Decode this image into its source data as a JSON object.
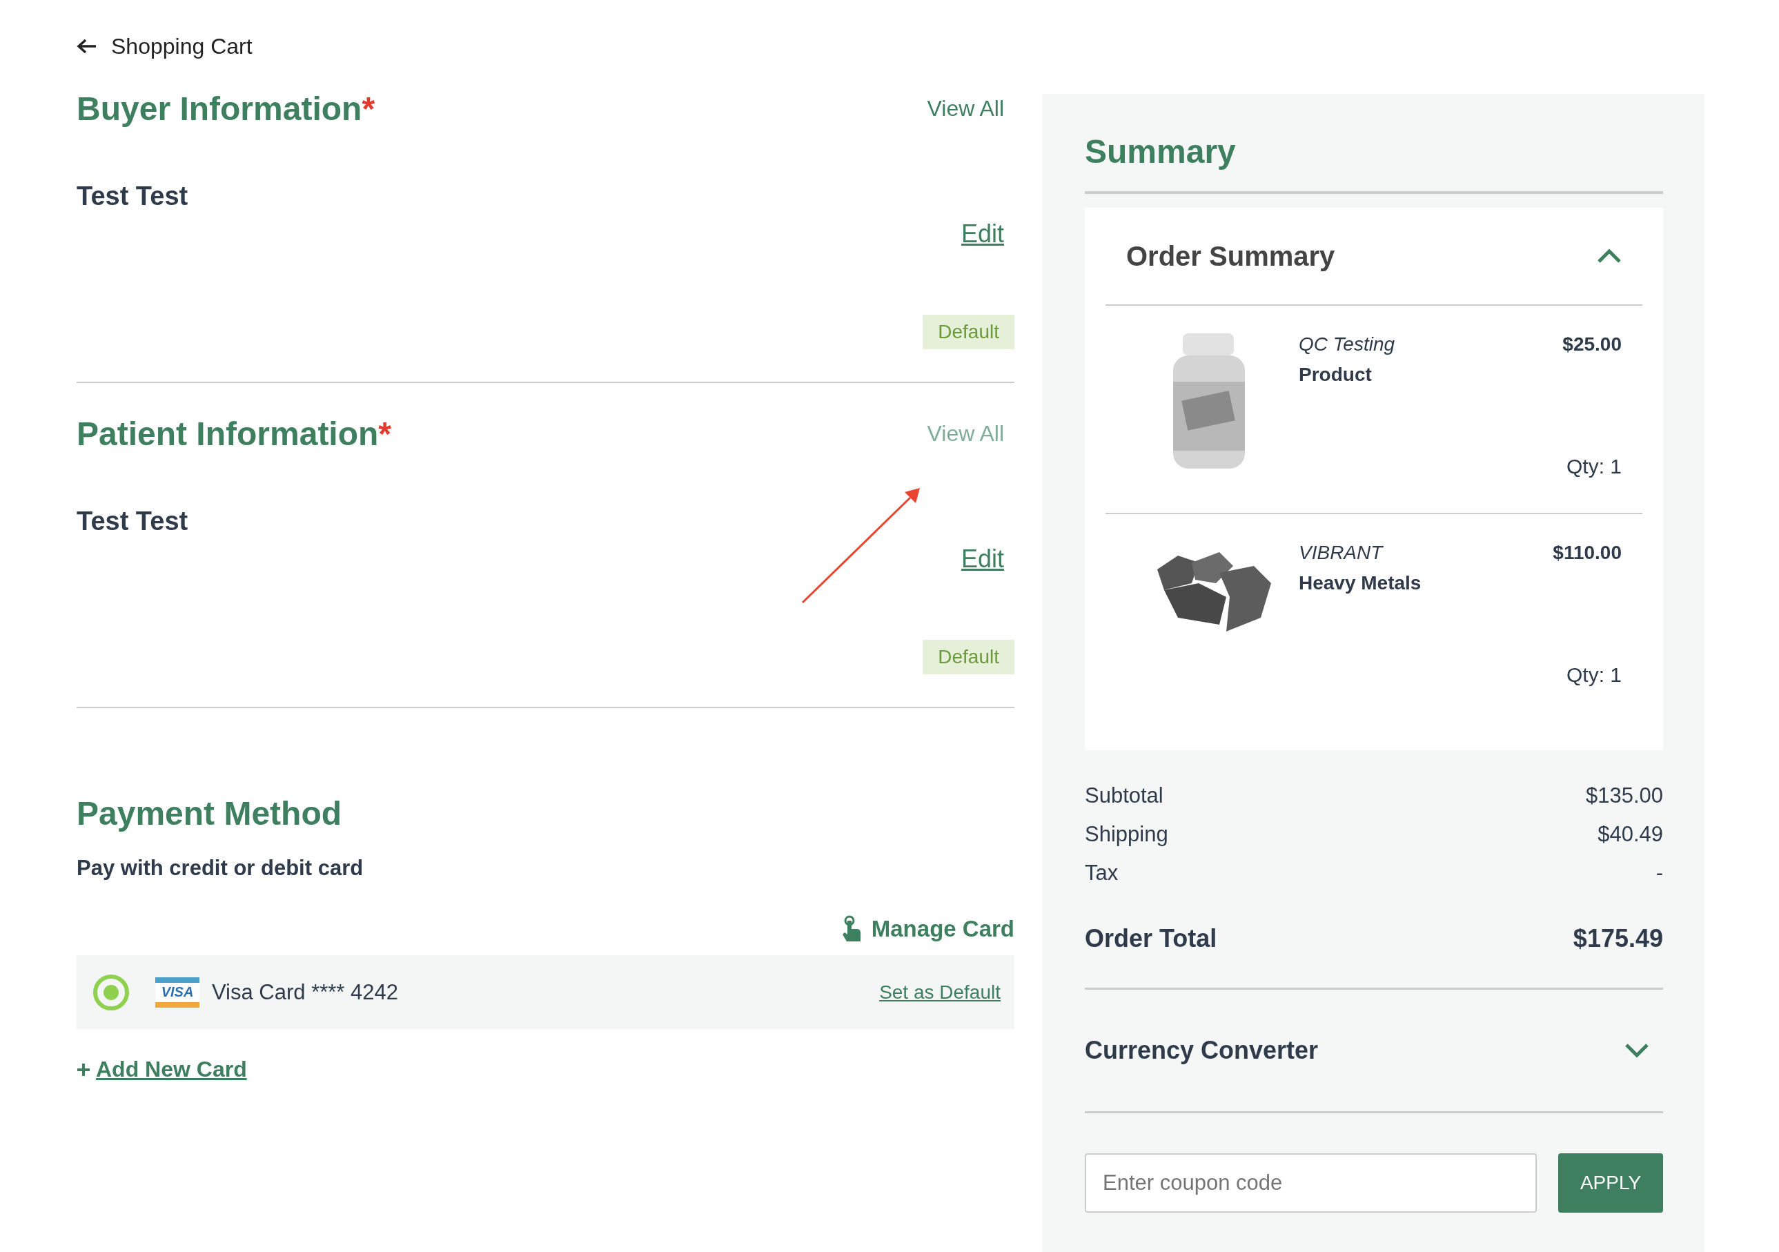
{
  "back": {
    "label": "Shopping Cart"
  },
  "sections": [
    {
      "title": "Buyer Information",
      "required": "*",
      "view_all": {
        "label": "View All",
        "dimmed": false
      },
      "name": "Test Test",
      "edit": "Edit",
      "badge": "Default"
    },
    {
      "title": "Patient Information",
      "required": "*",
      "view_all": {
        "label": "View All",
        "dimmed": true
      },
      "name": "Test Test",
      "edit": "Edit",
      "badge": "Default"
    }
  ],
  "payment": {
    "title": "Payment Method",
    "subtitle": "Pay with credit or debit card",
    "manage": "Manage Card",
    "cards": [
      {
        "brand": "VISA",
        "label": "Visa Card **** 4242",
        "selected": true,
        "action": "Set as Default"
      }
    ],
    "add": "Add New Card"
  },
  "summary": {
    "title": "Summary",
    "order_summary": {
      "title": "Order Summary",
      "expanded": true,
      "items": [
        {
          "kind": "bottle",
          "brand": "QC Testing",
          "name": "Product",
          "price": "$25.00",
          "qty": "Qty: 1"
        },
        {
          "kind": "rocks",
          "brand": "VIBRANT",
          "name": "Heavy Metals",
          "price": "$110.00",
          "qty": "Qty: 1"
        }
      ]
    },
    "lines": [
      {
        "label": "Subtotal",
        "value": "$135.00"
      },
      {
        "label": "Shipping",
        "value": "$40.49"
      },
      {
        "label": "Tax",
        "value": "-"
      }
    ],
    "total": {
      "label": "Order Total",
      "value": "$175.49"
    },
    "currency": {
      "title": "Currency Converter",
      "expanded": false
    },
    "coupon": {
      "placeholder": "Enter coupon code",
      "button": "APPLY"
    }
  }
}
